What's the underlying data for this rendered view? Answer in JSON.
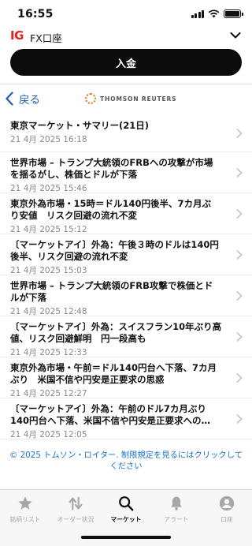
{
  "status_bar": {
    "time": "16:55"
  },
  "account": {
    "logo": "IG",
    "name": "FX口座"
  },
  "deposit_button": {
    "label": "入金"
  },
  "nav": {
    "back_label": "戻る",
    "provider_logo": "THOMSON REUTERS"
  },
  "news": [
    {
      "title_lines": [
        "東京マーケット・サマリー(21日)"
      ],
      "date": "21 4月 2025 16:18"
    },
    {
      "title_lines": [
        "世界市場 – トランプ大統領のFRBへの攻撃が市場",
        "を揺るがし、株価とドルが下落"
      ],
      "date": "21 4月 2025 15:46"
    },
    {
      "title_lines": [
        "東京外為市場・15時＝ドル140円後半、7カ月ぶ",
        "り安値　リスク回避の流れ不変"
      ],
      "date": "21 4月 2025 15:12"
    },
    {
      "title_lines": [
        "〔マーケットアイ〕外為：午後３時のドルは140円",
        "後半、リスク回避の流れ不変"
      ],
      "date": "21 4月 2025 15:03"
    },
    {
      "title_lines": [
        "世界市場 – トランプ大統領のFRB攻撃で株価とド",
        "ルが下落"
      ],
      "date": "21 4月 2025 12:48"
    },
    {
      "title_lines": [
        "〔マーケットアイ〕外為：スイスフラン10年ぶり高",
        "値、リスク回避鮮明　円一段高も"
      ],
      "date": "21 4月 2025 12:33"
    },
    {
      "title_lines": [
        "東京外為市場・午前＝ドル140円台へ下落、7カ月",
        "ぶり　米国不信や円安是正要求の思惑"
      ],
      "date": "21 4月 2025 12:27"
    },
    {
      "title_lines": [
        "〔マーケットアイ〕外為：午前のドル7カ月ぶり",
        "140円台へ下落、米国不信や円安是正要求への…"
      ],
      "date": "21 4月 2025 12:05"
    }
  ],
  "copyright": "© 2025 トムソン・ロイター. 制限規定を見るにはクリックしてください",
  "tabs": [
    {
      "label": "銘柄リスト",
      "icon": "star-icon",
      "active": false
    },
    {
      "label": "オーダー状況",
      "icon": "transfer-arrows-icon",
      "active": false
    },
    {
      "label": "マーケット",
      "icon": "search-icon",
      "active": true
    },
    {
      "label": "アラート",
      "icon": "bell-icon",
      "active": false
    },
    {
      "label": "口座",
      "icon": "person-icon",
      "active": false
    }
  ],
  "colors": {
    "accent": "#1a5fb4",
    "brand_red": "#e2231a",
    "button_bg": "#0b0b0b",
    "date_gray": "#8a8a8a",
    "copyright_link": "#1a73c9"
  }
}
